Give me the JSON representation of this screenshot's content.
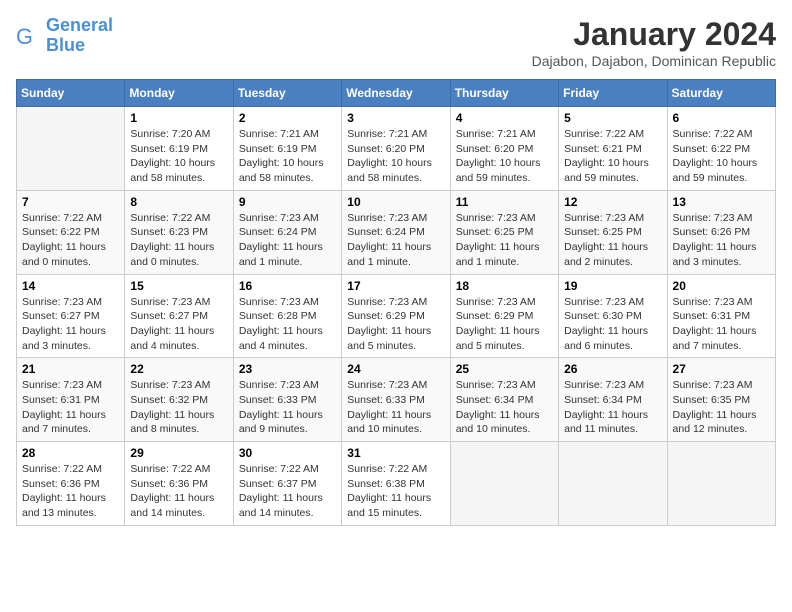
{
  "logo": {
    "text_general": "General",
    "text_blue": "Blue"
  },
  "header": {
    "month_year": "January 2024",
    "location": "Dajabon, Dajabon, Dominican Republic"
  },
  "weekdays": [
    "Sunday",
    "Monday",
    "Tuesday",
    "Wednesday",
    "Thursday",
    "Friday",
    "Saturday"
  ],
  "weeks": [
    [
      {
        "day": "",
        "info": ""
      },
      {
        "day": "1",
        "info": "Sunrise: 7:20 AM\nSunset: 6:19 PM\nDaylight: 10 hours\nand 58 minutes."
      },
      {
        "day": "2",
        "info": "Sunrise: 7:21 AM\nSunset: 6:19 PM\nDaylight: 10 hours\nand 58 minutes."
      },
      {
        "day": "3",
        "info": "Sunrise: 7:21 AM\nSunset: 6:20 PM\nDaylight: 10 hours\nand 58 minutes."
      },
      {
        "day": "4",
        "info": "Sunrise: 7:21 AM\nSunset: 6:20 PM\nDaylight: 10 hours\nand 59 minutes."
      },
      {
        "day": "5",
        "info": "Sunrise: 7:22 AM\nSunset: 6:21 PM\nDaylight: 10 hours\nand 59 minutes."
      },
      {
        "day": "6",
        "info": "Sunrise: 7:22 AM\nSunset: 6:22 PM\nDaylight: 10 hours\nand 59 minutes."
      }
    ],
    [
      {
        "day": "7",
        "info": "Sunrise: 7:22 AM\nSunset: 6:22 PM\nDaylight: 11 hours\nand 0 minutes."
      },
      {
        "day": "8",
        "info": "Sunrise: 7:22 AM\nSunset: 6:23 PM\nDaylight: 11 hours\nand 0 minutes."
      },
      {
        "day": "9",
        "info": "Sunrise: 7:23 AM\nSunset: 6:24 PM\nDaylight: 11 hours\nand 1 minute."
      },
      {
        "day": "10",
        "info": "Sunrise: 7:23 AM\nSunset: 6:24 PM\nDaylight: 11 hours\nand 1 minute."
      },
      {
        "day": "11",
        "info": "Sunrise: 7:23 AM\nSunset: 6:25 PM\nDaylight: 11 hours\nand 1 minute."
      },
      {
        "day": "12",
        "info": "Sunrise: 7:23 AM\nSunset: 6:25 PM\nDaylight: 11 hours\nand 2 minutes."
      },
      {
        "day": "13",
        "info": "Sunrise: 7:23 AM\nSunset: 6:26 PM\nDaylight: 11 hours\nand 3 minutes."
      }
    ],
    [
      {
        "day": "14",
        "info": "Sunrise: 7:23 AM\nSunset: 6:27 PM\nDaylight: 11 hours\nand 3 minutes."
      },
      {
        "day": "15",
        "info": "Sunrise: 7:23 AM\nSunset: 6:27 PM\nDaylight: 11 hours\nand 4 minutes."
      },
      {
        "day": "16",
        "info": "Sunrise: 7:23 AM\nSunset: 6:28 PM\nDaylight: 11 hours\nand 4 minutes."
      },
      {
        "day": "17",
        "info": "Sunrise: 7:23 AM\nSunset: 6:29 PM\nDaylight: 11 hours\nand 5 minutes."
      },
      {
        "day": "18",
        "info": "Sunrise: 7:23 AM\nSunset: 6:29 PM\nDaylight: 11 hours\nand 5 minutes."
      },
      {
        "day": "19",
        "info": "Sunrise: 7:23 AM\nSunset: 6:30 PM\nDaylight: 11 hours\nand 6 minutes."
      },
      {
        "day": "20",
        "info": "Sunrise: 7:23 AM\nSunset: 6:31 PM\nDaylight: 11 hours\nand 7 minutes."
      }
    ],
    [
      {
        "day": "21",
        "info": "Sunrise: 7:23 AM\nSunset: 6:31 PM\nDaylight: 11 hours\nand 7 minutes."
      },
      {
        "day": "22",
        "info": "Sunrise: 7:23 AM\nSunset: 6:32 PM\nDaylight: 11 hours\nand 8 minutes."
      },
      {
        "day": "23",
        "info": "Sunrise: 7:23 AM\nSunset: 6:33 PM\nDaylight: 11 hours\nand 9 minutes."
      },
      {
        "day": "24",
        "info": "Sunrise: 7:23 AM\nSunset: 6:33 PM\nDaylight: 11 hours\nand 10 minutes."
      },
      {
        "day": "25",
        "info": "Sunrise: 7:23 AM\nSunset: 6:34 PM\nDaylight: 11 hours\nand 10 minutes."
      },
      {
        "day": "26",
        "info": "Sunrise: 7:23 AM\nSunset: 6:34 PM\nDaylight: 11 hours\nand 11 minutes."
      },
      {
        "day": "27",
        "info": "Sunrise: 7:23 AM\nSunset: 6:35 PM\nDaylight: 11 hours\nand 12 minutes."
      }
    ],
    [
      {
        "day": "28",
        "info": "Sunrise: 7:22 AM\nSunset: 6:36 PM\nDaylight: 11 hours\nand 13 minutes."
      },
      {
        "day": "29",
        "info": "Sunrise: 7:22 AM\nSunset: 6:36 PM\nDaylight: 11 hours\nand 14 minutes."
      },
      {
        "day": "30",
        "info": "Sunrise: 7:22 AM\nSunset: 6:37 PM\nDaylight: 11 hours\nand 14 minutes."
      },
      {
        "day": "31",
        "info": "Sunrise: 7:22 AM\nSunset: 6:38 PM\nDaylight: 11 hours\nand 15 minutes."
      },
      {
        "day": "",
        "info": ""
      },
      {
        "day": "",
        "info": ""
      },
      {
        "day": "",
        "info": ""
      }
    ]
  ]
}
